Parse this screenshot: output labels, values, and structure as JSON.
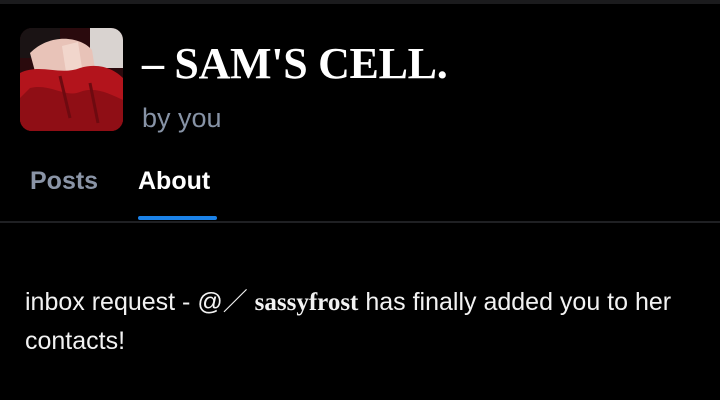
{
  "profile": {
    "title": "– SAM'S CELL.",
    "byline": "by you",
    "avatar_icon": "profile-photo"
  },
  "tabs": [
    {
      "label": "Posts",
      "active": false
    },
    {
      "label": "About",
      "active": true
    }
  ],
  "colors": {
    "background": "#000000",
    "accent": "#1b82e8",
    "muted_text": "#8793a6",
    "avatar_red": "#b3141c"
  },
  "about": {
    "text_before": "inbox request - @",
    "slash": "／",
    "handle": "sassyfrost",
    "text_after": " has finally added you to her contacts!"
  }
}
